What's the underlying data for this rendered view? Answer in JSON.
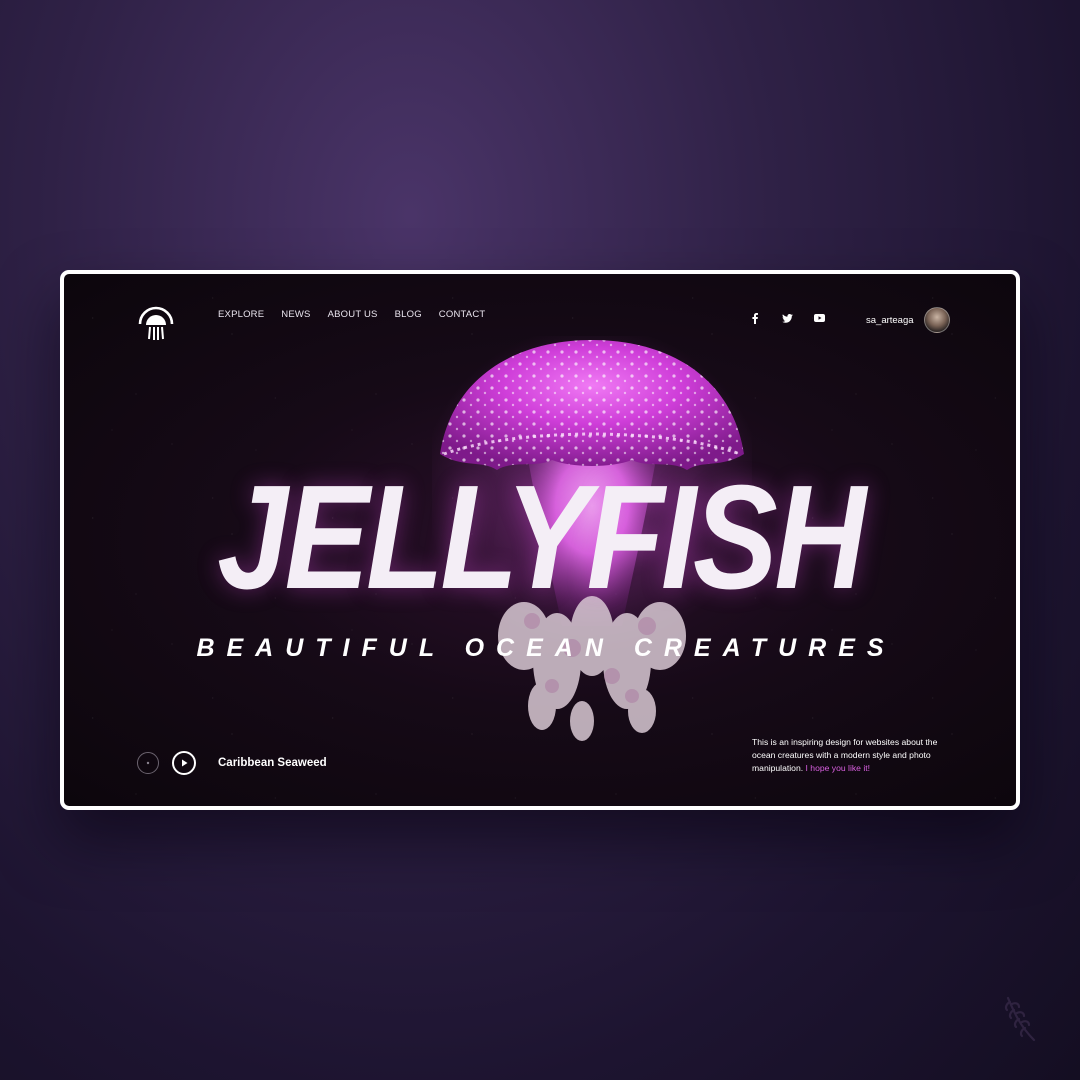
{
  "nav": {
    "items": [
      "EXPLORE",
      "NEWS",
      "ABOUT US",
      "BLOG",
      "CONTACT"
    ]
  },
  "social": {
    "icons": [
      "facebook-icon",
      "twitter-icon",
      "youtube-icon"
    ]
  },
  "user": {
    "name": "sa_arteaga"
  },
  "hero": {
    "title": "JELLYFISH",
    "subtitle": "BEAUTIFUL OCEAN CREATURES"
  },
  "player": {
    "track": "Caribbean Seaweed"
  },
  "description": {
    "text": "This is an inspiring design for websites about the ocean creatures with a modern style and photo manipulation.",
    "accent": "I hope you like it!"
  },
  "colors": {
    "accent": "#d95fe0",
    "jellyfish": "#c93fd4",
    "background": "#2f2146"
  }
}
